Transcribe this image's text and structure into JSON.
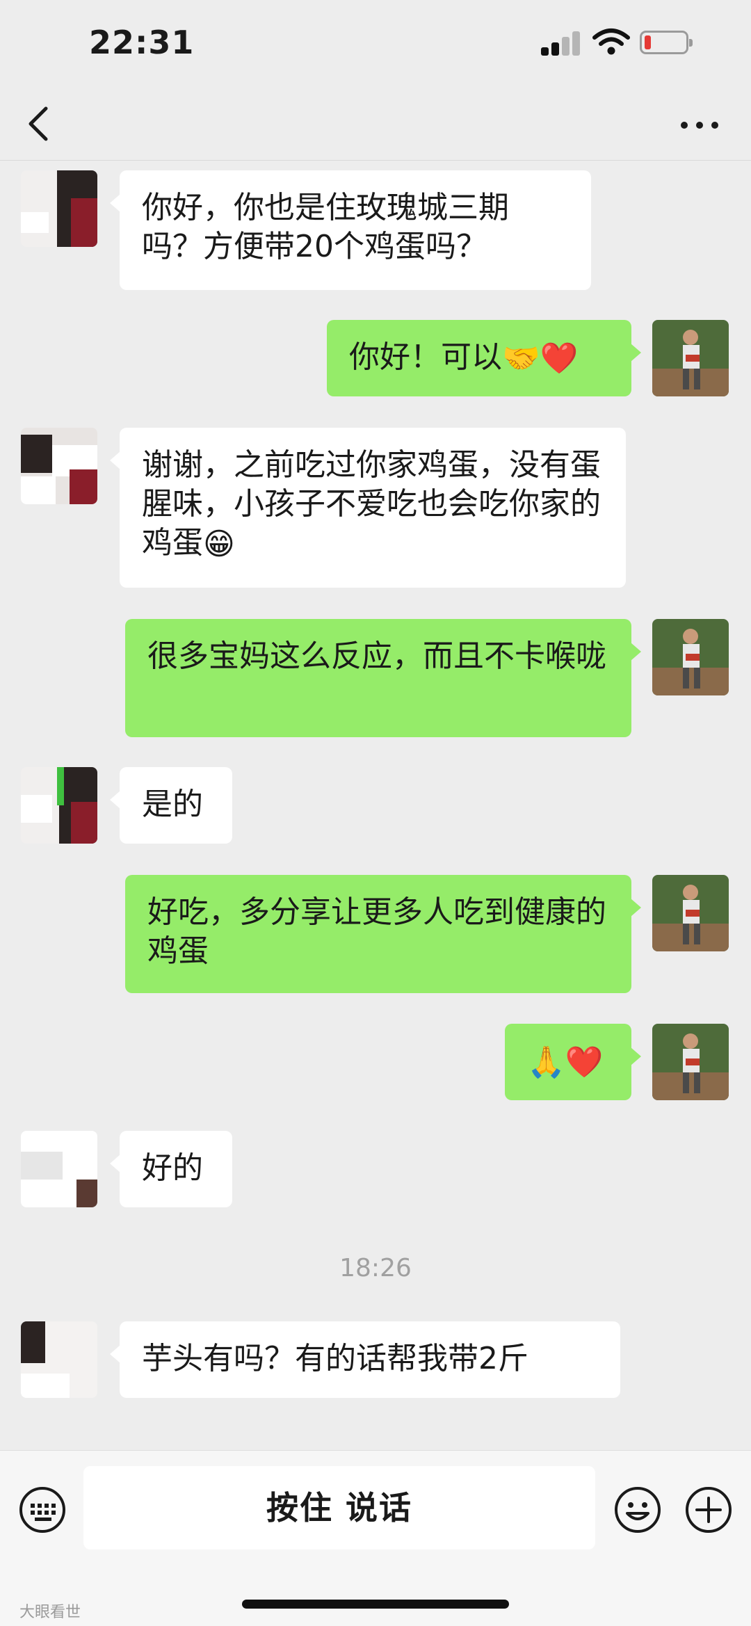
{
  "status_bar": {
    "time": "22:31",
    "battery_level": 0.15
  },
  "nav": {
    "back_icon": "chevron-left-icon",
    "more_icon": "more-dots-icon"
  },
  "messages": [
    {
      "side": "in",
      "text": "你好，你也是住玫瑰城三期吗？方便带20个鸡蛋吗？"
    },
    {
      "side": "out",
      "text": "你好！可以",
      "emojis": [
        "🤝",
        "❤️"
      ]
    },
    {
      "side": "in",
      "text": "谢谢，之前吃过你家鸡蛋，没有蛋腥味，小孩子不爱吃也会吃你家的鸡蛋",
      "emojis": [
        "😁"
      ]
    },
    {
      "side": "out",
      "text": "很多宝妈这么反应，而且不卡喉咙"
    },
    {
      "side": "in",
      "text": "是的"
    },
    {
      "side": "out",
      "text": "好吃，多分享让更多人吃到健康的鸡蛋"
    },
    {
      "side": "out",
      "text": "",
      "emojis": [
        "🙏",
        "❤️"
      ]
    },
    {
      "side": "in",
      "text": "好的"
    },
    {
      "side": "in",
      "text": "芋头有吗？有的话帮我带2斤"
    }
  ],
  "timestamp": "18:26",
  "input_bar": {
    "hold_to_talk": "按住 说话",
    "keyboard_icon": "keyboard-icon",
    "emoji_icon": "emoji-icon",
    "plus_icon": "plus-circle-icon"
  },
  "watermark": "大眼看世",
  "colors": {
    "background": "#ededed",
    "incoming_bubble": "#ffffff",
    "outgoing_bubble": "#95ec69"
  }
}
